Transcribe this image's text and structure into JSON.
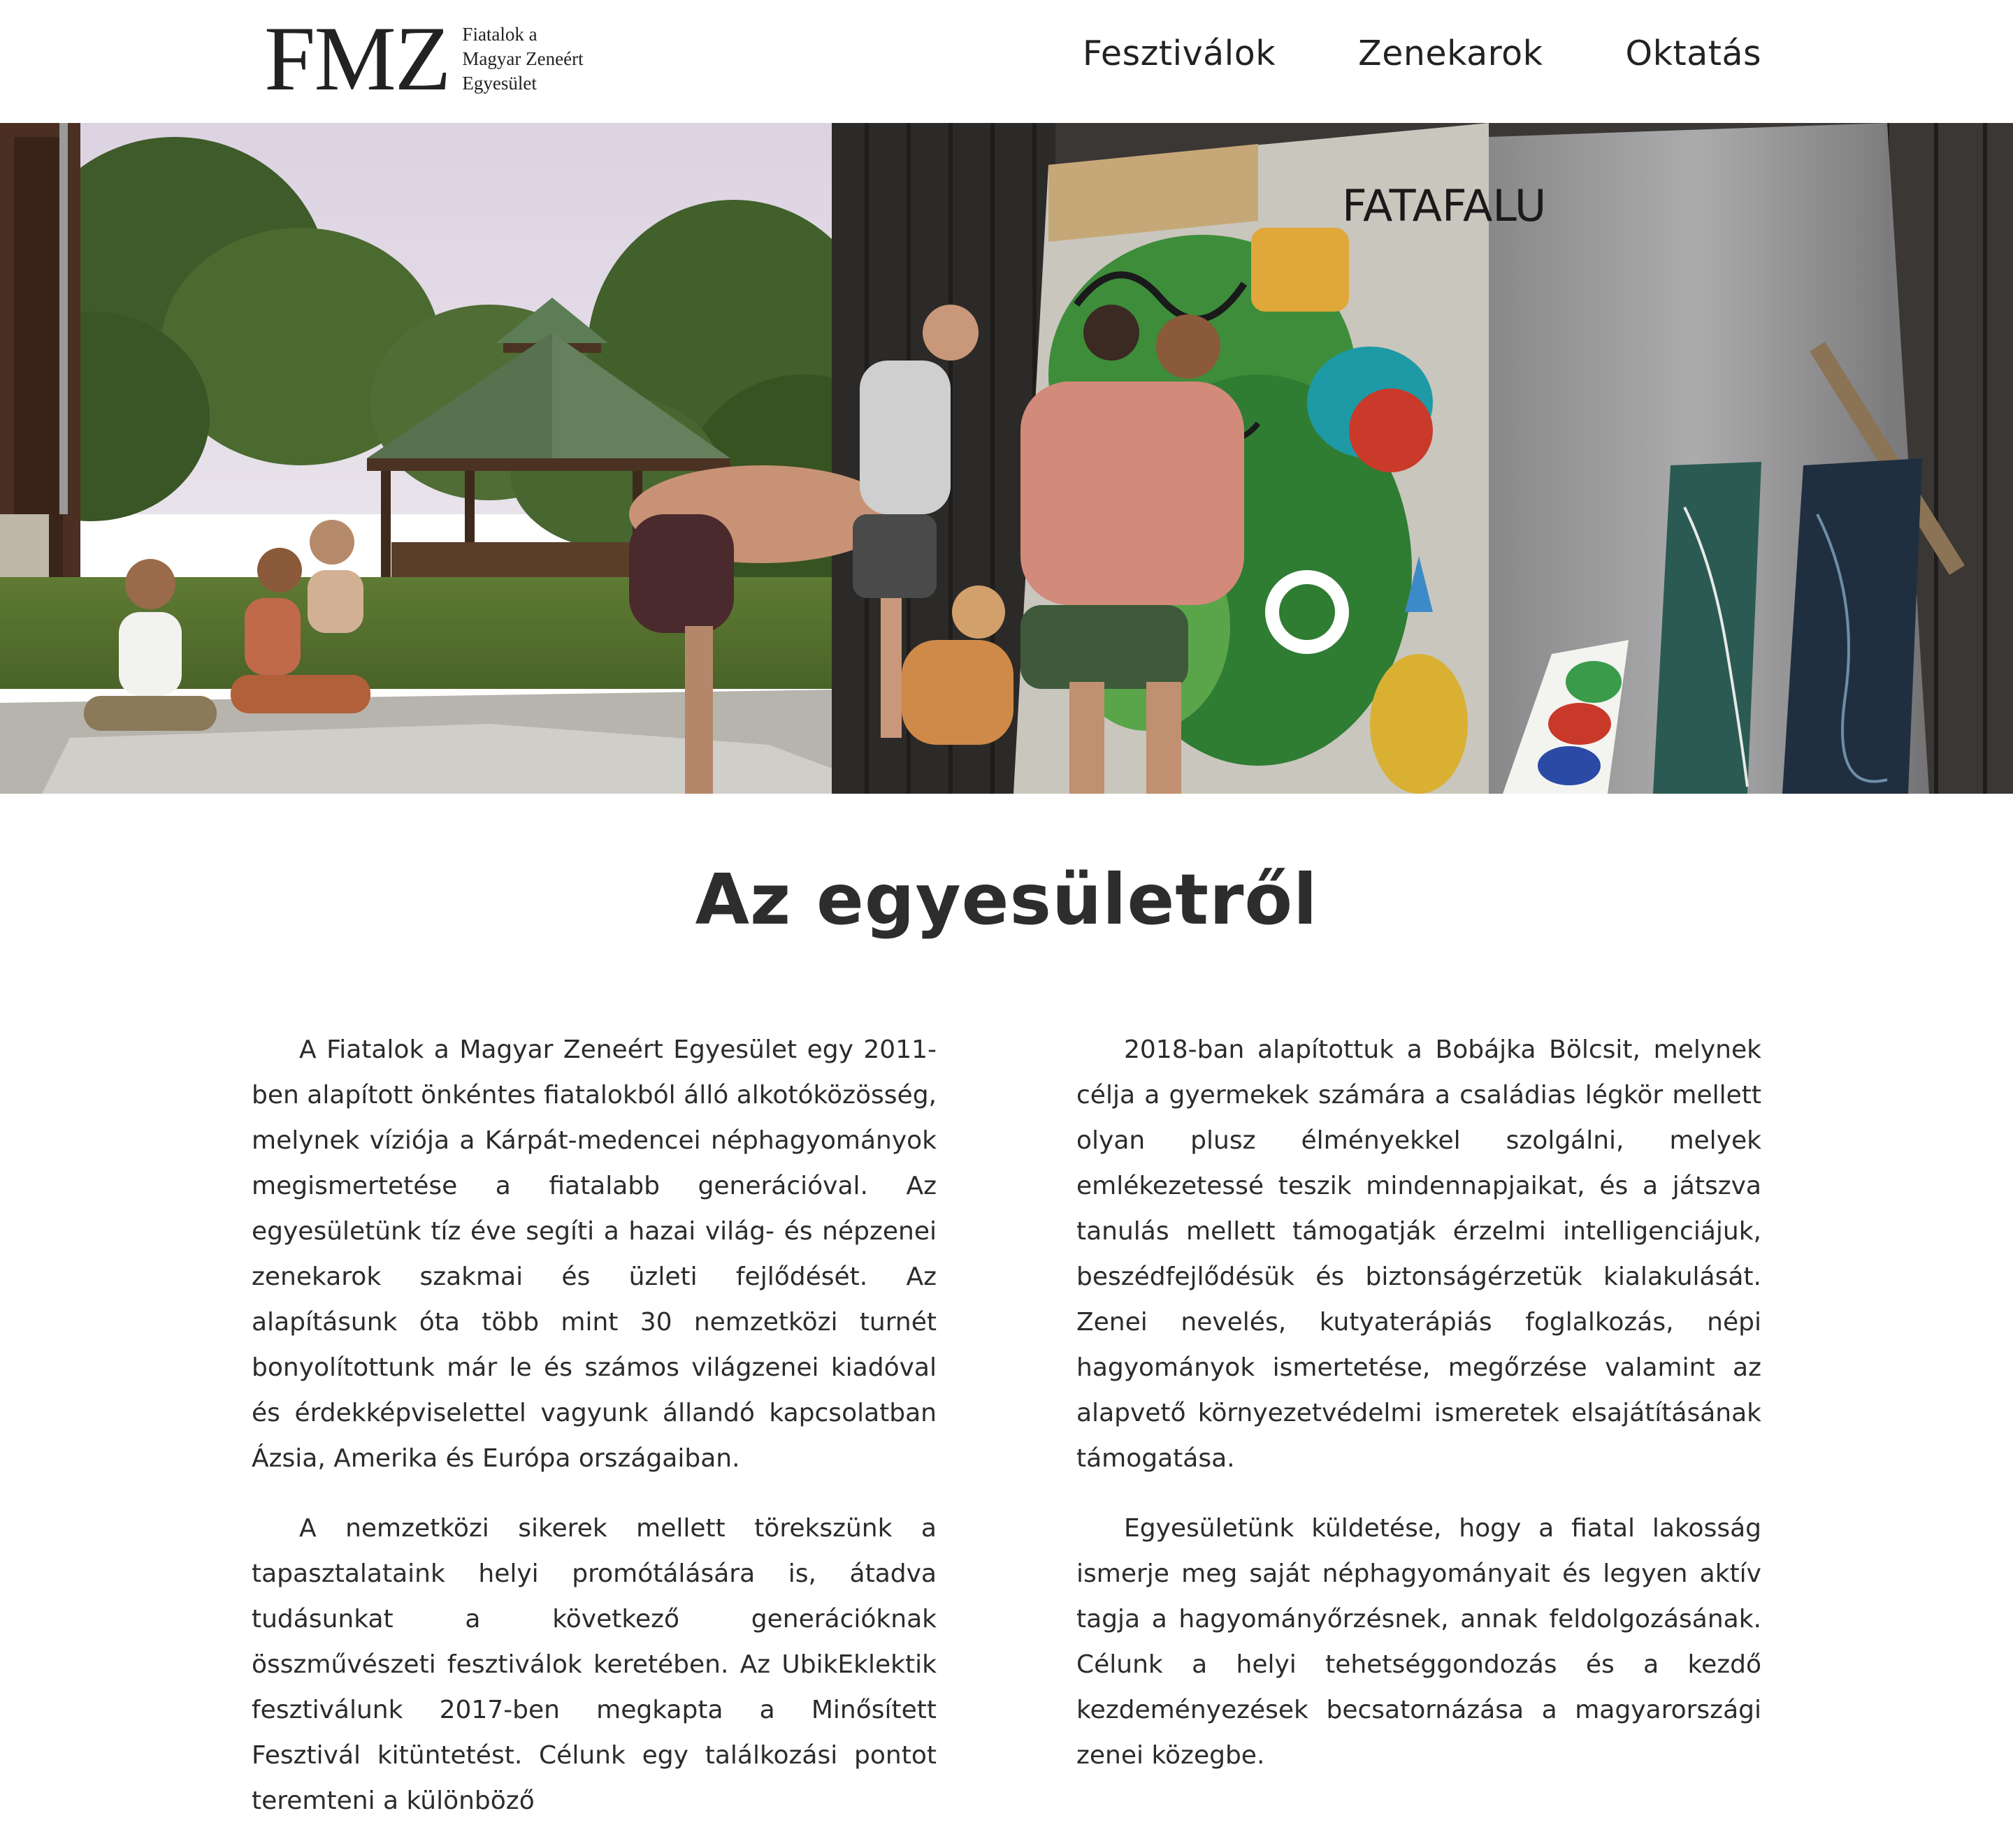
{
  "header": {
    "logo": {
      "mark": "FMZ",
      "lines": [
        "Fiatalok a",
        "Magyar Zeneért",
        "Egyesület"
      ]
    },
    "nav": [
      "Fesztiválok",
      "Zenekarok",
      "Oktatás"
    ]
  },
  "hero": {
    "mural_text": "FATAFALU"
  },
  "about": {
    "title": "Az egyesületről",
    "left": [
      "A Fiatalok a Magyar Zeneért Egyesület egy 2011-ben alapított önkéntes fiatalokból álló alkotóközösség, melynek víziója a Kárpát-medencei néphagyományok megismertetése a fiatalabb generációval. Az egyesületünk tíz éve segíti a hazai világ- és népzenei zenekarok szakmai és üzleti fejlődését. Az alapításunk óta több mint 30 nemzetközi turnét bonyolítottunk már le és számos világzenei kiadóval és érdekképviselettel vagyunk állandó kapcsolatban Ázsia, Amerika és Európa országaiban.",
      "A nemzetközi sikerek mellett törekszünk a tapasztalataink helyi promótálására is, átadva tudásunkat a következő generációknak összművészeti fesztiválok keretében. Az UbikEklektik fesztiválunk 2017-ben megkapta a Minősített Fesztivál kitüntetést. Célunk egy találkozási pontot teremteni a különböző"
    ],
    "right": [
      "2018-ban alapítottuk a Bobájka Bölcsit, melynek célja a gyermekek számára a családias légkör mellett olyan plusz élményekkel szolgálni, melyek emlékezetessé teszik mindennapjaikat, és a játszva tanulás mellett támogatják érzelmi intelligenciájuk, beszédfejlődésük és biztonságérzetük kialakulását. Zenei nevelés, kutyaterápiás foglalkozás, népi hagyományok ismertetése, megőrzése valamint az alapvető környezetvédelmi ismeretek elsajátításának támogatása.",
      "Egyesületünk küldetése, hogy a fiatal lakosság ismerje meg saját néphagyományait és legyen aktív tagja a hagyományőrzésnek, annak feldolgozásának. Célunk a helyi tehetséggondozás és a kezdő kezdeményezések becsatornázása a magyarországi zenei közegbe."
    ]
  }
}
